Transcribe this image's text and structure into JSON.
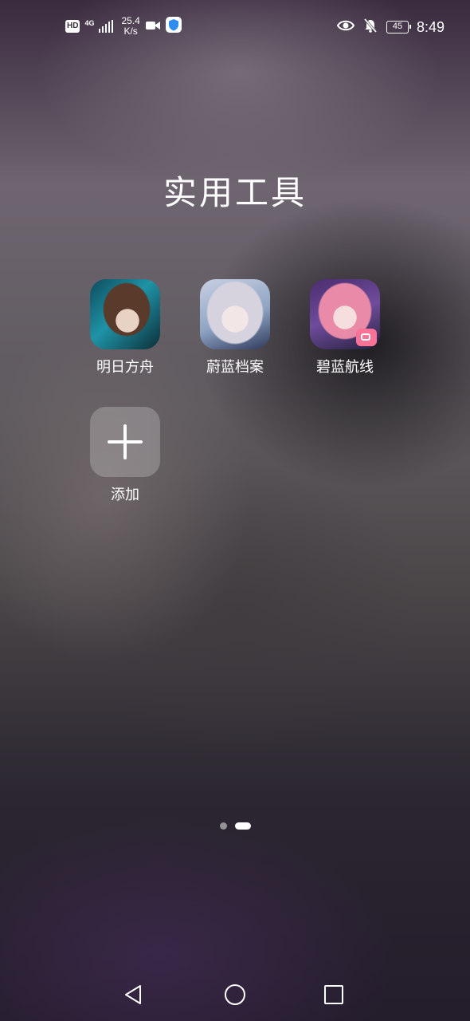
{
  "status_bar": {
    "hd_label": "HD",
    "network_type": "4G",
    "net_speed_value": "25.4",
    "net_speed_unit": "K/s",
    "battery_level": "45",
    "time": "8:49",
    "icons": [
      "hd-icon",
      "signal-icon",
      "video-camera-icon",
      "shield-icon",
      "eye-icon",
      "bell-off-icon",
      "battery-icon"
    ]
  },
  "folder": {
    "title": "实用工具",
    "apps": [
      {
        "label": "明日方舟",
        "icon": "arknights-app-icon"
      },
      {
        "label": "蔚蓝档案",
        "icon": "blue-archive-app-icon"
      },
      {
        "label": "碧蓝航线",
        "icon": "azur-lane-app-icon"
      },
      {
        "label": "添加",
        "icon": "plus-icon"
      }
    ]
  },
  "page_indicator": {
    "total_pages": 2,
    "current_page": 2
  },
  "nav_bar": {
    "buttons": [
      "back-triangle-icon",
      "home-circle-icon",
      "recents-square-icon"
    ]
  },
  "colors": {
    "text": "#ffffff",
    "bilibili_badge": "#fb7299",
    "shield": "#2f8cf0"
  }
}
